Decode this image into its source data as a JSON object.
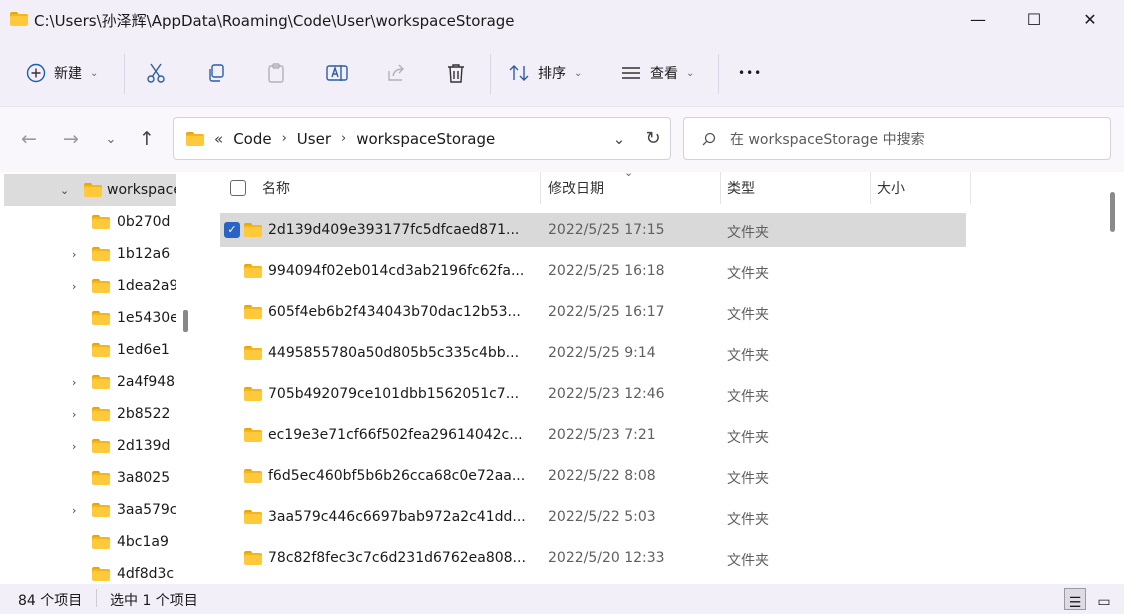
{
  "window": {
    "title": "C:\\Users\\孙泽辉\\AppData\\Roaming\\Code\\User\\workspaceStorage",
    "minimize": "—",
    "maximize": "☐",
    "close": "✕"
  },
  "toolbar": {
    "new_label": "新建",
    "sort_label": "排序",
    "view_label": "查看",
    "more": "•••"
  },
  "address": {
    "overflow": "«",
    "crumbs": [
      "Code",
      "User",
      "workspaceStorage"
    ],
    "separator": "›"
  },
  "search": {
    "placeholder": "在 workspaceStorage 中搜索"
  },
  "tree": {
    "root": "workspace",
    "items": [
      "0b270d",
      "1b12a6",
      "1dea2a9",
      "1e5430e",
      "1ed6e1",
      "2a4f948",
      "2b8522",
      "2d139d",
      "3a8025",
      "3aa579c",
      "4bc1a9",
      "4df8d3c"
    ]
  },
  "columns": {
    "name": "名称",
    "date": "修改日期",
    "type": "类型",
    "size": "大小"
  },
  "files": [
    {
      "name": "2d139d409e393177fc5dfcaed871...",
      "date": "2022/5/25 17:15",
      "type": "文件夹"
    },
    {
      "name": "994094f02eb014cd3ab2196fc62fa...",
      "date": "2022/5/25 16:18",
      "type": "文件夹"
    },
    {
      "name": "605f4eb6b2f434043b70dac12b53...",
      "date": "2022/5/25 16:17",
      "type": "文件夹"
    },
    {
      "name": "4495855780a50d805b5c335c4bb...",
      "date": "2022/5/25 9:14",
      "type": "文件夹"
    },
    {
      "name": "705b492079ce101dbb1562051c7...",
      "date": "2022/5/23 12:46",
      "type": "文件夹"
    },
    {
      "name": "ec19e3e71cf66f502fea29614042c...",
      "date": "2022/5/23 7:21",
      "type": "文件夹"
    },
    {
      "name": "f6d5ec460bf5b6b26cca68c0e72aa...",
      "date": "2022/5/22 8:08",
      "type": "文件夹"
    },
    {
      "name": "3aa579c446c6697bab972a2c41dd...",
      "date": "2022/5/22 5:03",
      "type": "文件夹"
    },
    {
      "name": "78c82f8fec3c7c6d231d6762ea808...",
      "date": "2022/5/20 12:33",
      "type": "文件夹"
    }
  ],
  "status": {
    "count": "84 个项目",
    "selected": "选中 1 个项目"
  },
  "colors": {
    "chrome_bg": "#f3eff8",
    "folder": "#ffc93c",
    "selection": "#d9d9d9",
    "checkbox": "#2a63c4"
  }
}
